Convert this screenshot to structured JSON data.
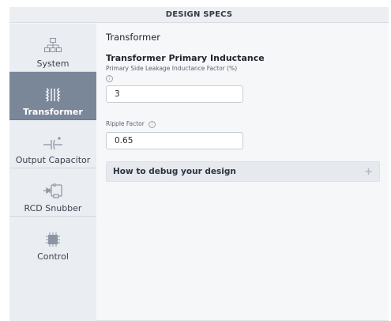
{
  "header": {
    "title": "DESIGN SPECS"
  },
  "sidebar": {
    "items": [
      {
        "label": "System",
        "icon": "system-icon",
        "active": false
      },
      {
        "label": "Transformer",
        "icon": "transformer-icon",
        "active": true
      },
      {
        "label": "Output Capacitor",
        "icon": "capacitor-icon",
        "active": false
      },
      {
        "label": "RCD Snubber",
        "icon": "snubber-icon",
        "active": false
      },
      {
        "label": "Control",
        "icon": "chip-icon",
        "active": false
      }
    ]
  },
  "main": {
    "section_title": "Transformer",
    "subsection_title": "Transformer Primary Inductance",
    "fields": [
      {
        "label": "Primary Side Leakage Inductance Factor (%)",
        "value": "3",
        "info_glyph": "i"
      },
      {
        "label": "Ripple Factor",
        "value": "0.65",
        "info_glyph": "i"
      }
    ],
    "accordion": {
      "label": "How to debug your design",
      "toggle": "+"
    }
  },
  "colors": {
    "active_nav": "#7a8799",
    "sidebar_bg": "#eaedf1",
    "content_bg": "#f6f7f9"
  }
}
